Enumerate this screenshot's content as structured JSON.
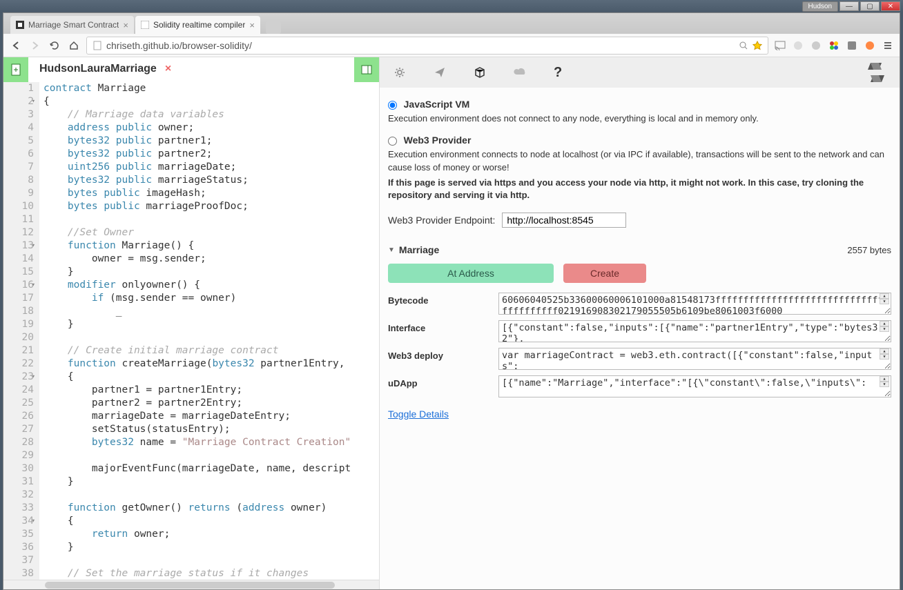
{
  "os": {
    "user_badge": "Hudson"
  },
  "browser": {
    "tabs": [
      {
        "title": "Marriage Smart Contract",
        "active": false
      },
      {
        "title": "Solidity realtime compiler",
        "active": true
      }
    ],
    "url": "chriseth.github.io/browser-solidity/"
  },
  "editor": {
    "filename": "HudsonLauraMarriage",
    "lines": [
      "1",
      "2",
      "3",
      "4",
      "5",
      "6",
      "7",
      "8",
      "9",
      "10",
      "11",
      "12",
      "13",
      "14",
      "15",
      "16",
      "17",
      "18",
      "19",
      "20",
      "21",
      "22",
      "23",
      "24",
      "25",
      "26",
      "27",
      "28",
      "29",
      "30",
      "31",
      "32",
      "33",
      "34",
      "35",
      "36",
      "37",
      "38"
    ],
    "code_html": "<span class='kw'>contract</span> Marriage\n{\n    <span class='cm'>// Marriage data variables</span>\n    <span class='ty'>address</span> <span class='kw'>public</span> owner;\n    <span class='ty'>bytes32</span> <span class='kw'>public</span> partner1;\n    <span class='ty'>bytes32</span> <span class='kw'>public</span> partner2;\n    <span class='ty'>uint256</span> <span class='kw'>public</span> marriageDate;\n    <span class='ty'>bytes32</span> <span class='kw'>public</span> marriageStatus;\n    <span class='ty'>bytes</span> <span class='kw'>public</span> imageHash;\n    <span class='ty'>bytes</span> <span class='kw'>public</span> marriageProofDoc;\n\n    <span class='cm'>//Set Owner</span>\n    <span class='kw'>function</span> Marriage() {\n        owner = msg.sender;\n    }\n    <span class='kw'>modifier</span> onlyowner() {\n        <span class='kw'>if</span> (msg.sender == owner)\n            _\n    }\n\n    <span class='cm'>// Create initial marriage contract</span>\n    <span class='kw'>function</span> createMarriage(<span class='ty'>bytes32</span> partner1Entry,\n    {\n        partner1 = partner1Entry;\n        partner2 = partner2Entry;\n        marriageDate = marriageDateEntry;\n        setStatus(statusEntry);\n        <span class='ty'>bytes32</span> name = <span class='st'>\"Marriage Contract Creation\"</span>\n\n        majorEventFunc(marriageDate, name, descript\n    }\n\n    <span class='kw'>function</span> getOwner() <span class='kw'>returns</span> (<span class='ty'>address</span> owner)\n    {\n        <span class='kw'>return</span> owner;\n    }\n\n    <span class='cm'>// Set the marriage status if it changes</span>"
  },
  "compiler": {
    "env": {
      "jsvm_title": "JavaScript VM",
      "jsvm_desc": "Execution environment does not connect to any node, everything is local and in memory only.",
      "web3_title": "Web3 Provider",
      "web3_desc": "Execution environment connects to node at localhost (or via IPC if available), transactions will be sent to the network and can cause loss of money or worse!",
      "web3_warning": "If this page is served via https and you access your node via http, it might not work. In this case, try cloning the repository and serving it via http.",
      "endpoint_label": "Web3 Provider Endpoint:",
      "endpoint_value": "http://localhost:8545"
    },
    "contract": {
      "name": "Marriage",
      "bytes": "2557 bytes",
      "at_address_label": "At Address",
      "create_label": "Create",
      "bytecode_label": "Bytecode",
      "bytecode_value": "60606040525b33600060006101000a81548173ffffffffffffffffffffffffffffffffffffffff021916908302179055505b6109be8061003f6000",
      "interface_label": "Interface",
      "interface_value": "[{\"constant\":false,\"inputs\":[{\"name\":\"partner1Entry\",\"type\":\"bytes32\"},",
      "web3deploy_label": "Web3 deploy",
      "web3deploy_value": "var marriageContract = web3.eth.contract([{\"constant\":false,\"inputs\":",
      "udapp_label": "uDApp",
      "udapp_value": "[{\"name\":\"Marriage\",\"interface\":\"[{\\\"constant\\\":false,\\\"inputs\\\":",
      "toggle_label": "Toggle Details"
    }
  }
}
